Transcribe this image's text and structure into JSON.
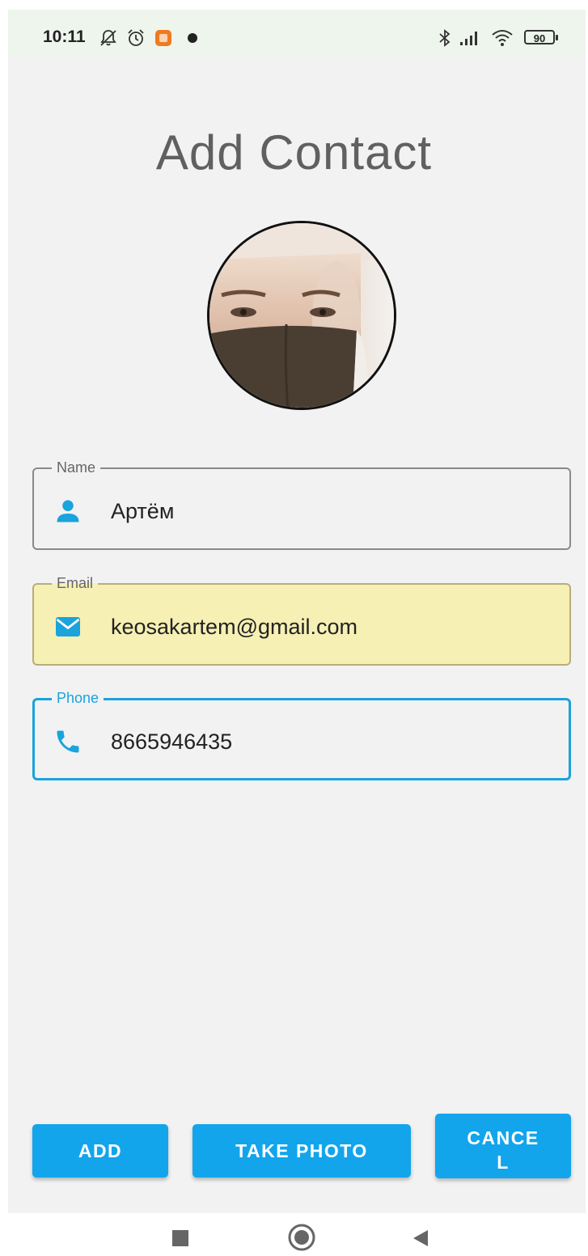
{
  "status_bar": {
    "time": "10:11",
    "battery": "90",
    "icons": [
      "notifications-off-icon",
      "alarm-icon",
      "app-notification-icon",
      "dot-icon",
      "bluetooth-icon",
      "signal-icon",
      "wifi-icon",
      "battery-icon"
    ]
  },
  "page": {
    "title": "Add Contact"
  },
  "avatar": {
    "icon": "contact-photo"
  },
  "form": {
    "name": {
      "label": "Name",
      "value": "Артём",
      "icon": "person-icon"
    },
    "email": {
      "label": "Email",
      "value": "keosakartem@gmail.com",
      "icon": "mail-icon"
    },
    "phone": {
      "label": "Phone",
      "value": "8665946435",
      "icon": "phone-icon"
    }
  },
  "actions": {
    "add": "ADD",
    "take_photo": "TAKE PHOTO",
    "cancel": "CANCE\nL"
  },
  "colors": {
    "accent": "#12a5ec",
    "focus_border": "#1aa3dc",
    "autofill_background": "#f6f0b4",
    "screen_background": "#f2f2f2"
  },
  "nav_bar": {
    "icons": [
      "recents-square-icon",
      "home-circle-icon",
      "back-triangle-icon"
    ]
  }
}
